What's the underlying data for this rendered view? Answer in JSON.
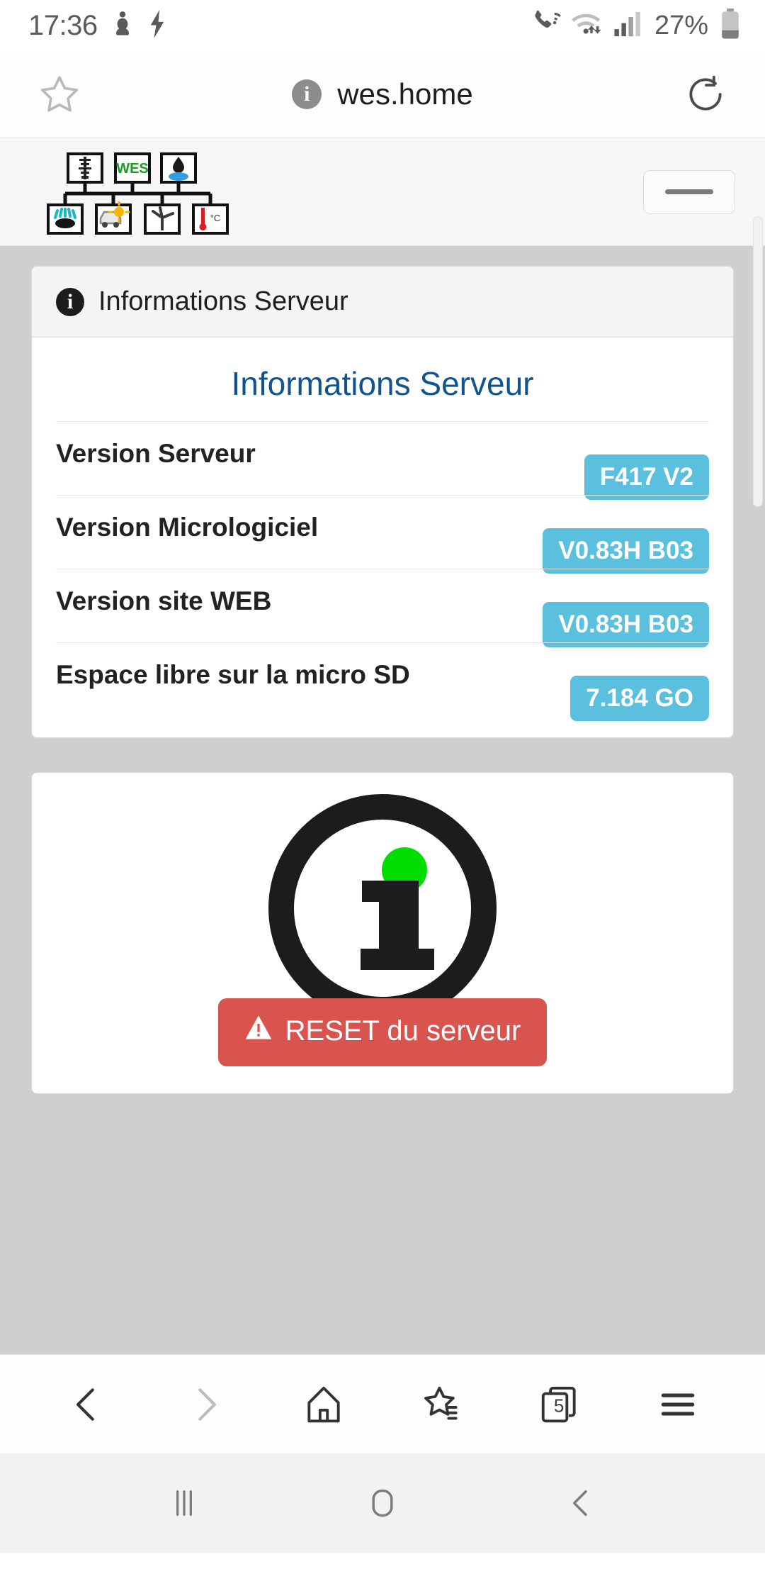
{
  "status_bar": {
    "time": "17:36",
    "battery_percent": "27%",
    "icons": [
      "do-not-disturb-icon",
      "charging-bolt-icon",
      "wifi-calling-icon",
      "wifi-icon",
      "signal-bars-icon",
      "battery-icon"
    ]
  },
  "browser_top": {
    "bookmark_icon": "star-outline-icon",
    "site_info_icon": "info-circle-icon",
    "url": "wes.home",
    "reload_icon": "reload-icon"
  },
  "site_header": {
    "logo_name": "wes-tree-logo",
    "logo_text": "WES",
    "logo_nodes_top": [
      "power-pylon-icon",
      "wes-label",
      "water-drop-icon"
    ],
    "logo_nodes_bottom": [
      "solar-panel-icon",
      "car-charging-icon",
      "wind-turbine-icon",
      "thermometer-icon"
    ],
    "menu_button_icon": "collapsed-navbar-icon"
  },
  "info_card": {
    "header_icon": "info-circle-icon",
    "header_title": "Informations Serveur",
    "panel_title": "Informations Serveur",
    "rows": [
      {
        "label": "Version Serveur",
        "value": "F417 V2"
      },
      {
        "label": "Version Micrologiciel",
        "value": "V0.83H B03"
      },
      {
        "label": "Version site WEB",
        "value": "V0.83H B03"
      },
      {
        "label": "Espace libre sur la micro SD",
        "value": "7.184 GO"
      }
    ]
  },
  "status_card": {
    "graphic_icon": "large-info-circle-icon",
    "status_dot_color": "#00dd00",
    "reset_button": {
      "warning_icon": "warning-triangle-icon",
      "label": "RESET du serveur",
      "color": "#d9534f"
    }
  },
  "browser_bottom": {
    "items": [
      {
        "name": "back-icon",
        "label": ""
      },
      {
        "name": "forward-icon",
        "label": ""
      },
      {
        "name": "home-icon",
        "label": ""
      },
      {
        "name": "bookmarks-icon",
        "label": ""
      },
      {
        "name": "tabs-icon",
        "label": "5"
      },
      {
        "name": "menu-icon",
        "label": ""
      }
    ],
    "tab_count": "5"
  },
  "nav_bar": {
    "recents_icon": "recents-icon",
    "home_icon": "home-square-icon",
    "back_icon": "back-chevron-icon"
  },
  "colors": {
    "badge": "#5bc0de",
    "panel_title": "#10538f",
    "danger": "#d9534f",
    "logo_green": "#1a9c23"
  }
}
